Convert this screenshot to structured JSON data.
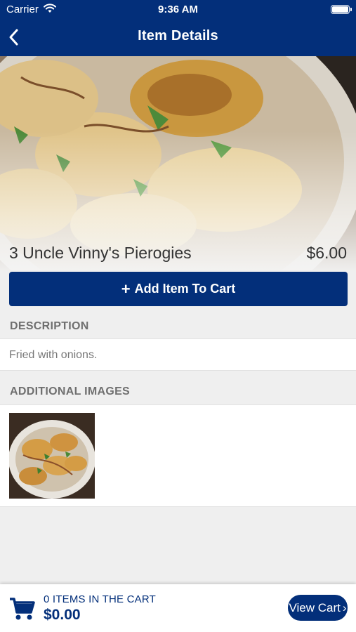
{
  "status_bar": {
    "carrier": "Carrier",
    "time": "9:36 AM"
  },
  "nav": {
    "title": "Item Details",
    "back_icon": "chevron-left-icon"
  },
  "item": {
    "name": "3 Uncle Vinny's Pierogies",
    "price": "$6.00",
    "add_button_label": "Add Item To Cart"
  },
  "description": {
    "header": "DESCRIPTION",
    "text": "Fried with onions."
  },
  "additional_images": {
    "header": "ADDITIONAL IMAGES"
  },
  "cart": {
    "count_label": "0 ITEMS IN THE CART",
    "total": "$0.00",
    "view_cart_label": "View Cart",
    "view_cart_arrow": "›"
  },
  "colors": {
    "brand": "#032f7a",
    "background": "#efefef"
  }
}
